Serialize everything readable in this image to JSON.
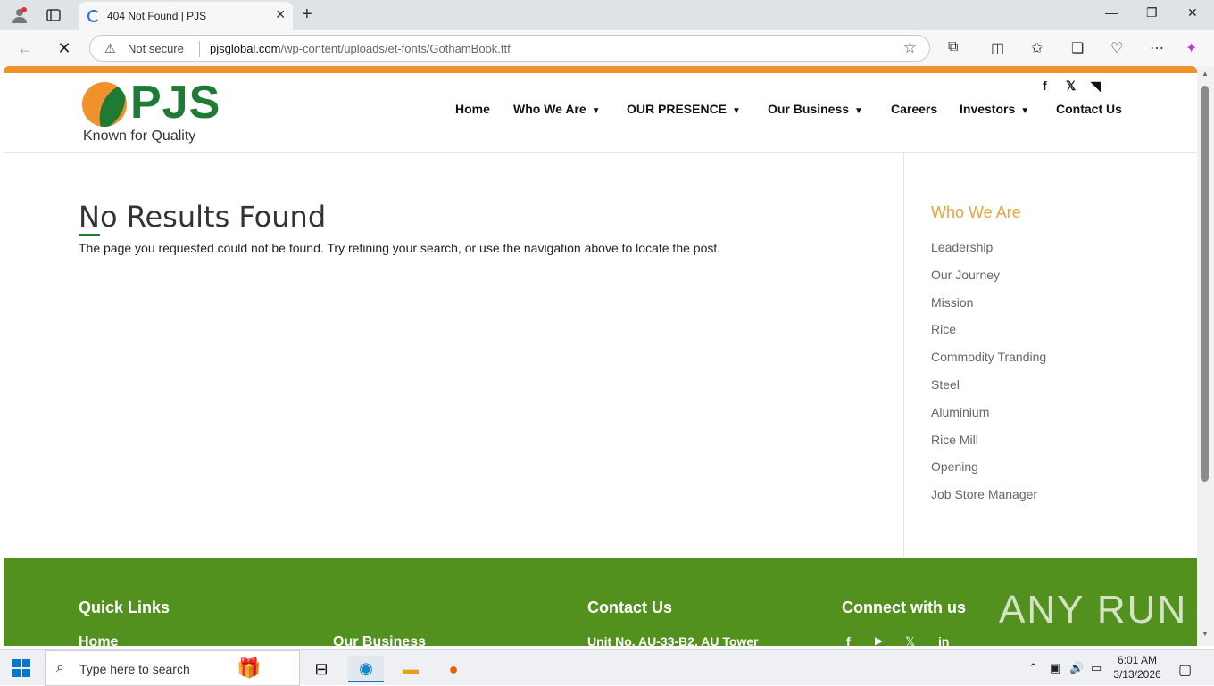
{
  "browser": {
    "tab_title": "404 Not Found | PJS",
    "address": {
      "security_label": "Not secure",
      "url_host": "pjsglobal.com",
      "url_path": "/wp-content/uploads/et-fonts/GothamBook.ttf"
    }
  },
  "site": {
    "logo_text": "PJS",
    "logo_tagline": "Known for Quality",
    "menu": [
      {
        "label": "Home"
      },
      {
        "label": "Who We Are"
      },
      {
        "label": "OUR PRESENCE"
      },
      {
        "label": "Our Business"
      },
      {
        "label": "Careers"
      },
      {
        "label": "Investors"
      },
      {
        "label": "Contact Us"
      }
    ],
    "social_top": {
      "facebook": "f",
      "x": "𝕏",
      "rss": "◥"
    }
  },
  "main": {
    "title": "No Results Found",
    "text": "The page you requested could not be found. Try refining your search, or use the navigation above to locate the post."
  },
  "sidebar": {
    "heading": "Who We Are",
    "links": [
      "Leadership",
      "Our Journey",
      "Mission",
      "Rice",
      "Commodity Tranding",
      "Steel",
      "Aluminium",
      "Rice Mill",
      "Opening",
      "Job Store Manager"
    ]
  },
  "footer": {
    "quick_links_heading": "Quick Links",
    "quick_link_home": "Home",
    "quick_link_business": "Our Business",
    "contact_heading": "Contact Us",
    "contact_address": "Unit No. AU-33-B2, AU Tower",
    "connect_heading": "Connect with us",
    "watermark": "ANY  RUN",
    "social": {
      "facebook": "f",
      "youtube": "▶",
      "x": "𝕏",
      "linkedin": "in"
    }
  },
  "taskbar": {
    "search_placeholder": "Type here to search",
    "time": "6:01 AM",
    "date": "3/13/2026"
  },
  "colors": {
    "brand_green": "#1e7a34",
    "brand_orange": "#f0922b",
    "footer_green": "#53911f",
    "sidebar_heading": "#e8a23e"
  }
}
